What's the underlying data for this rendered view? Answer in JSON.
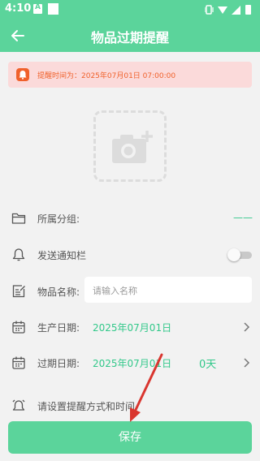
{
  "status_bar": {
    "time": "4:10"
  },
  "header": {
    "title": "物品过期提醒"
  },
  "alert": {
    "text": "提醒时间为：2025年07月01日 07:00:00"
  },
  "fields": {
    "category": {
      "label": "所属分组:",
      "value": "——"
    },
    "notify": {
      "label": "发送通知栏",
      "enabled": false
    },
    "name": {
      "label": "物品名称:",
      "placeholder": "请输入名称",
      "value": ""
    },
    "production_date": {
      "label": "生产日期:",
      "value": "2025年07月01日"
    },
    "expiry_date": {
      "label": "过期日期:",
      "value": "2025年07月01日",
      "days": "0天"
    },
    "reminder": {
      "label": "请设置提醒方式和时间"
    }
  },
  "actions": {
    "save": "保存"
  },
  "colors": {
    "primary": "#5bd49b",
    "accent_text": "#32c88a",
    "alert_bg": "#fbdada",
    "alert_text": "#f0612b",
    "annotation_arrow": "#d9362f"
  },
  "icons": [
    "back-arrow-icon",
    "bell-icon",
    "add-photo-icon",
    "folder-icon",
    "notification-bell-icon",
    "edit-icon",
    "calendar-icon",
    "chevron-right-icon",
    "alarm-bell-icon"
  ]
}
